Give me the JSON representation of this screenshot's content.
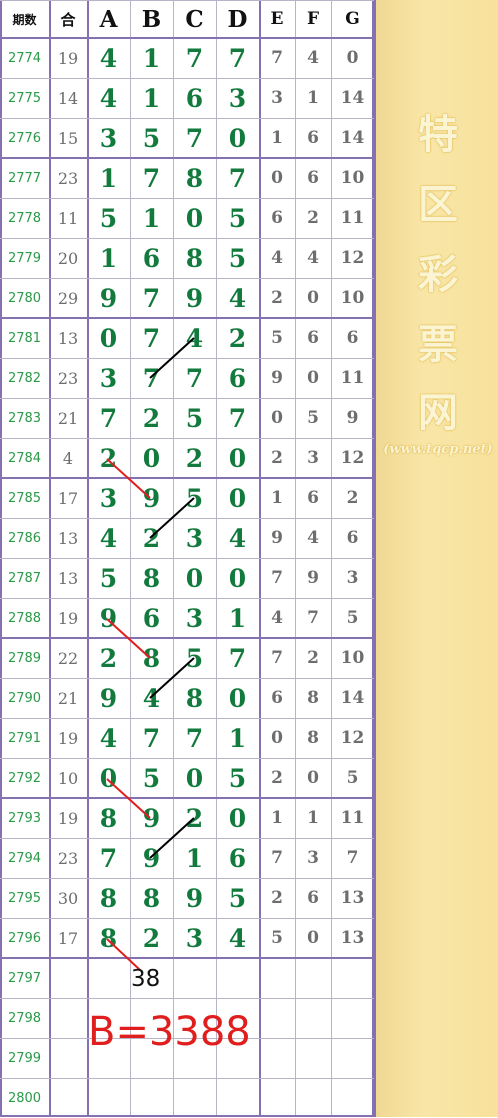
{
  "header": {
    "period": "期数",
    "sum": "合",
    "a": "A",
    "b": "B",
    "c": "C",
    "d": "D",
    "e": "E",
    "f": "F",
    "g": "G"
  },
  "rows": [
    {
      "period": "2774",
      "sum": "19",
      "a": "4",
      "b": "1",
      "c": "7",
      "d": "7",
      "e": "7",
      "f": "4",
      "g": "0"
    },
    {
      "period": "2775",
      "sum": "14",
      "a": "4",
      "b": "1",
      "c": "6",
      "d": "3",
      "e": "3",
      "f": "1",
      "g": "14"
    },
    {
      "period": "2776",
      "sum": "15",
      "a": "3",
      "b": "5",
      "c": "7",
      "d": "0",
      "e": "1",
      "f": "6",
      "g": "14"
    },
    {
      "period": "2777",
      "sum": "23",
      "a": "1",
      "b": "7",
      "c": "8",
      "d": "7",
      "e": "0",
      "f": "6",
      "g": "10"
    },
    {
      "period": "2778",
      "sum": "11",
      "a": "5",
      "b": "1",
      "c": "0",
      "d": "5",
      "e": "6",
      "f": "2",
      "g": "11"
    },
    {
      "period": "2779",
      "sum": "20",
      "a": "1",
      "b": "6",
      "c": "8",
      "d": "5",
      "e": "4",
      "f": "4",
      "g": "12"
    },
    {
      "period": "2780",
      "sum": "29",
      "a": "9",
      "b": "7",
      "c": "9",
      "d": "4",
      "e": "2",
      "f": "0",
      "g": "10"
    },
    {
      "period": "2781",
      "sum": "13",
      "a": "0",
      "b": "7",
      "c": "4",
      "d": "2",
      "e": "5",
      "f": "6",
      "g": "6"
    },
    {
      "period": "2782",
      "sum": "23",
      "a": "3",
      "b": "7",
      "c": "7",
      "d": "6",
      "e": "9",
      "f": "0",
      "g": "11"
    },
    {
      "period": "2783",
      "sum": "21",
      "a": "7",
      "b": "2",
      "c": "5",
      "d": "7",
      "e": "0",
      "f": "5",
      "g": "9"
    },
    {
      "period": "2784",
      "sum": "4",
      "a": "2",
      "b": "0",
      "c": "2",
      "d": "0",
      "e": "2",
      "f": "3",
      "g": "12"
    },
    {
      "period": "2785",
      "sum": "17",
      "a": "3",
      "b": "9",
      "c": "5",
      "d": "0",
      "e": "1",
      "f": "6",
      "g": "2"
    },
    {
      "period": "2786",
      "sum": "13",
      "a": "4",
      "b": "2",
      "c": "3",
      "d": "4",
      "e": "9",
      "f": "4",
      "g": "6"
    },
    {
      "period": "2787",
      "sum": "13",
      "a": "5",
      "b": "8",
      "c": "0",
      "d": "0",
      "e": "7",
      "f": "9",
      "g": "3"
    },
    {
      "period": "2788",
      "sum": "19",
      "a": "9",
      "b": "6",
      "c": "3",
      "d": "1",
      "e": "4",
      "f": "7",
      "g": "5"
    },
    {
      "period": "2789",
      "sum": "22",
      "a": "2",
      "b": "8",
      "c": "5",
      "d": "7",
      "e": "7",
      "f": "2",
      "g": "10"
    },
    {
      "period": "2790",
      "sum": "21",
      "a": "9",
      "b": "4",
      "c": "8",
      "d": "0",
      "e": "6",
      "f": "8",
      "g": "14"
    },
    {
      "period": "2791",
      "sum": "19",
      "a": "4",
      "b": "7",
      "c": "7",
      "d": "1",
      "e": "0",
      "f": "8",
      "g": "12"
    },
    {
      "period": "2792",
      "sum": "10",
      "a": "0",
      "b": "5",
      "c": "0",
      "d": "5",
      "e": "2",
      "f": "0",
      "g": "5"
    },
    {
      "period": "2793",
      "sum": "19",
      "a": "8",
      "b": "9",
      "c": "2",
      "d": "0",
      "e": "1",
      "f": "1",
      "g": "11"
    },
    {
      "period": "2794",
      "sum": "23",
      "a": "7",
      "b": "9",
      "c": "1",
      "d": "6",
      "e": "7",
      "f": "3",
      "g": "7"
    },
    {
      "period": "2795",
      "sum": "30",
      "a": "8",
      "b": "8",
      "c": "9",
      "d": "5",
      "e": "2",
      "f": "6",
      "g": "13"
    },
    {
      "period": "2796",
      "sum": "17",
      "a": "8",
      "b": "2",
      "c": "3",
      "d": "4",
      "e": "5",
      "f": "0",
      "g": "13"
    },
    {
      "period": "2797",
      "sum": "",
      "a": "",
      "b": "",
      "c": "",
      "d": "",
      "e": "",
      "f": "",
      "g": ""
    },
    {
      "period": "2798",
      "sum": "",
      "a": "",
      "b": "",
      "c": "",
      "d": "",
      "e": "",
      "f": "",
      "g": ""
    },
    {
      "period": "2799",
      "sum": "",
      "a": "",
      "b": "",
      "c": "",
      "d": "",
      "e": "",
      "f": "",
      "g": ""
    },
    {
      "period": "2800",
      "sum": "",
      "a": "",
      "b": "",
      "c": "",
      "d": "",
      "e": "",
      "f": "",
      "g": ""
    }
  ],
  "annotations": {
    "number": "38",
    "prediction": "B=3388"
  },
  "watermark": {
    "chars": [
      "特",
      "区",
      "彩",
      "票",
      "网"
    ],
    "url": "(www.tqcp.net)"
  },
  "colors": {
    "digit": "#137a3e",
    "period": "#2a9a48",
    "secondary": "#6d6d6d",
    "border": "#8570b2",
    "red_line": "#e01e1e",
    "black_line": "#000000",
    "panel": "#f7e19c"
  }
}
